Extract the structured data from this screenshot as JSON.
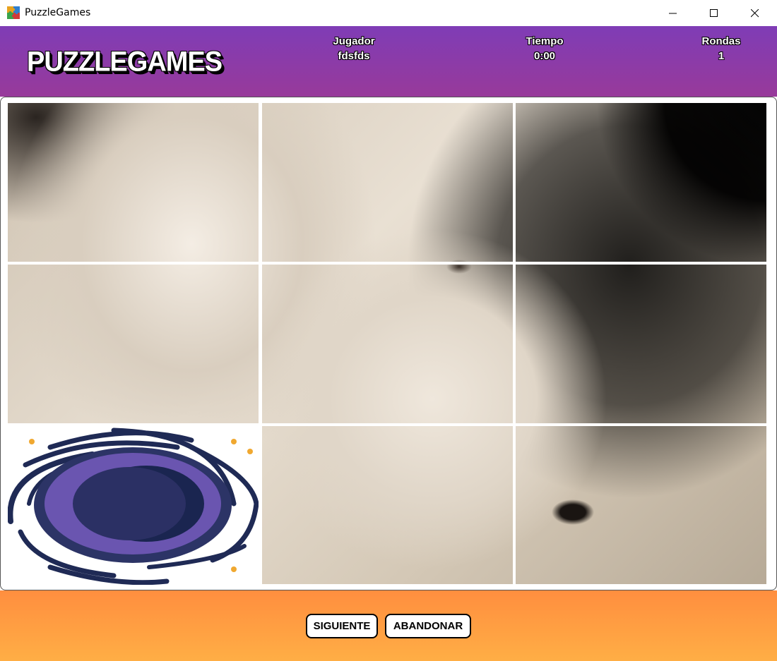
{
  "window": {
    "title": "PuzzleGames",
    "icon": "puzzle-app-icon",
    "controls": [
      "minimize-icon",
      "maximize-icon",
      "close-icon"
    ]
  },
  "header": {
    "logo": "PUZZLEGAMES",
    "player_label": "Jugador",
    "player_value": "fdsfds",
    "time_label": "Tiempo",
    "time_value": "0:00",
    "rounds_label": "Rondas",
    "rounds_value": "1"
  },
  "board": {
    "grid": "3x3",
    "tiles": [
      {
        "content": "lion-piece-1"
      },
      {
        "content": "lion-piece-2"
      },
      {
        "content": "lion-piece-3"
      },
      {
        "content": "lion-piece-4"
      },
      {
        "content": "lion-piece-5"
      },
      {
        "content": "lion-piece-6"
      },
      {
        "content": "black-hole-icon"
      },
      {
        "content": "lion-piece-8"
      },
      {
        "content": "lion-piece-9"
      }
    ]
  },
  "footer": {
    "next_label": "SIGUIENTE",
    "quit_label": "ABANDONAR"
  },
  "colors": {
    "header_top": "#7f3cb6",
    "header_bottom": "#983a9a",
    "footer_top": "#ff8e3f",
    "footer_bottom": "#ffae45",
    "black_hole_purple": "#6a55b0",
    "black_hole_navy": "#262b58",
    "star_yellow": "#f0a830"
  }
}
